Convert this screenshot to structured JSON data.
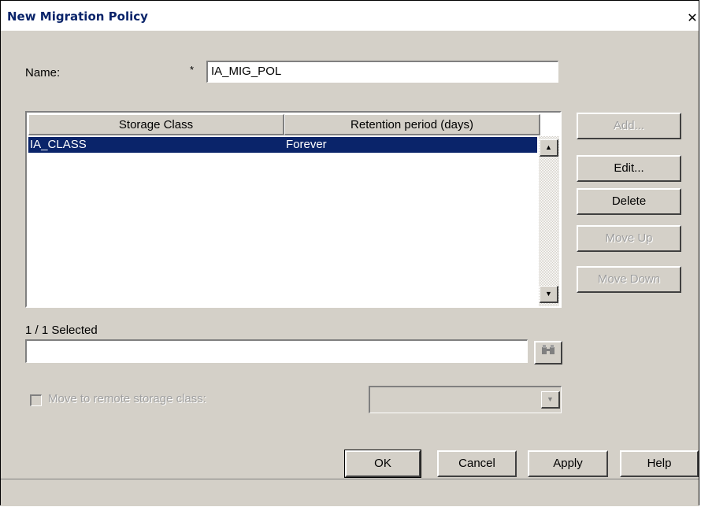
{
  "window": {
    "title": "New Migration Policy",
    "close_glyph": "✕"
  },
  "name_field": {
    "label": "Name:",
    "required_marker": "*",
    "value": "IA_MIG_POL"
  },
  "table": {
    "columns": [
      "Storage Class",
      "Retention period (days)"
    ],
    "rows": [
      {
        "storage_class": "IA_CLASS",
        "retention": "Forever",
        "selected": true
      }
    ]
  },
  "side_buttons": {
    "add": "Add...",
    "edit": "Edit...",
    "delete": "Delete",
    "move_up": "Move Up",
    "move_down": "Move Down"
  },
  "selection": {
    "count_text": "1 / 1 Selected",
    "search_value": ""
  },
  "remote": {
    "checkbox_label": "Move to remote storage class:",
    "checked": false,
    "combo_value": ""
  },
  "footer_buttons": {
    "ok": "OK",
    "cancel": "Cancel",
    "apply": "Apply",
    "help": "Help"
  },
  "icons": {
    "find": "binoculars-icon",
    "scroll_up": "arrow-up-icon",
    "scroll_down": "arrow-down-icon",
    "combo_dropdown": "chevron-down-icon"
  },
  "colors": {
    "selection": "#0a246a",
    "title_text": "#0a246a",
    "face": "#d4d0c8"
  }
}
